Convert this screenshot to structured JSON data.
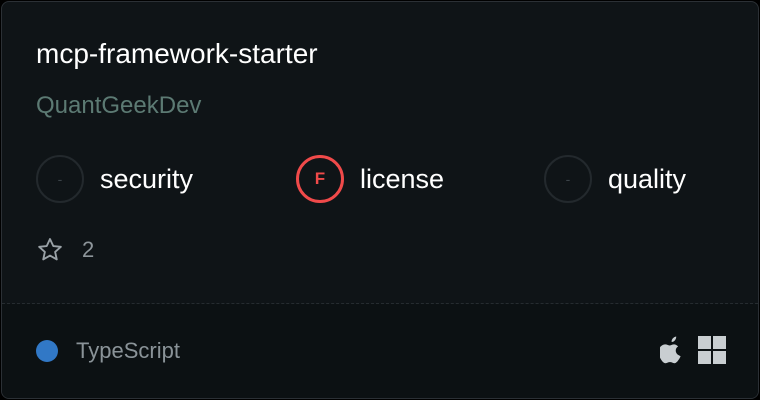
{
  "repo": {
    "name": "mcp-framework-starter",
    "owner": "QuantGeekDev"
  },
  "scores": [
    {
      "label": "security",
      "grade": "-",
      "status": "none"
    },
    {
      "label": "license",
      "grade": "F",
      "status": "fail"
    },
    {
      "label": "quality",
      "grade": "-",
      "status": "none"
    }
  ],
  "stars": {
    "count": "2",
    "icon": "star-outline-icon"
  },
  "language": {
    "name": "TypeScript",
    "color": "#3178c6"
  },
  "platforms": [
    {
      "icon": "apple-icon"
    },
    {
      "icon": "windows-icon"
    }
  ],
  "colors": {
    "fail": "#f04a4a",
    "owner": "#5c7a73"
  }
}
